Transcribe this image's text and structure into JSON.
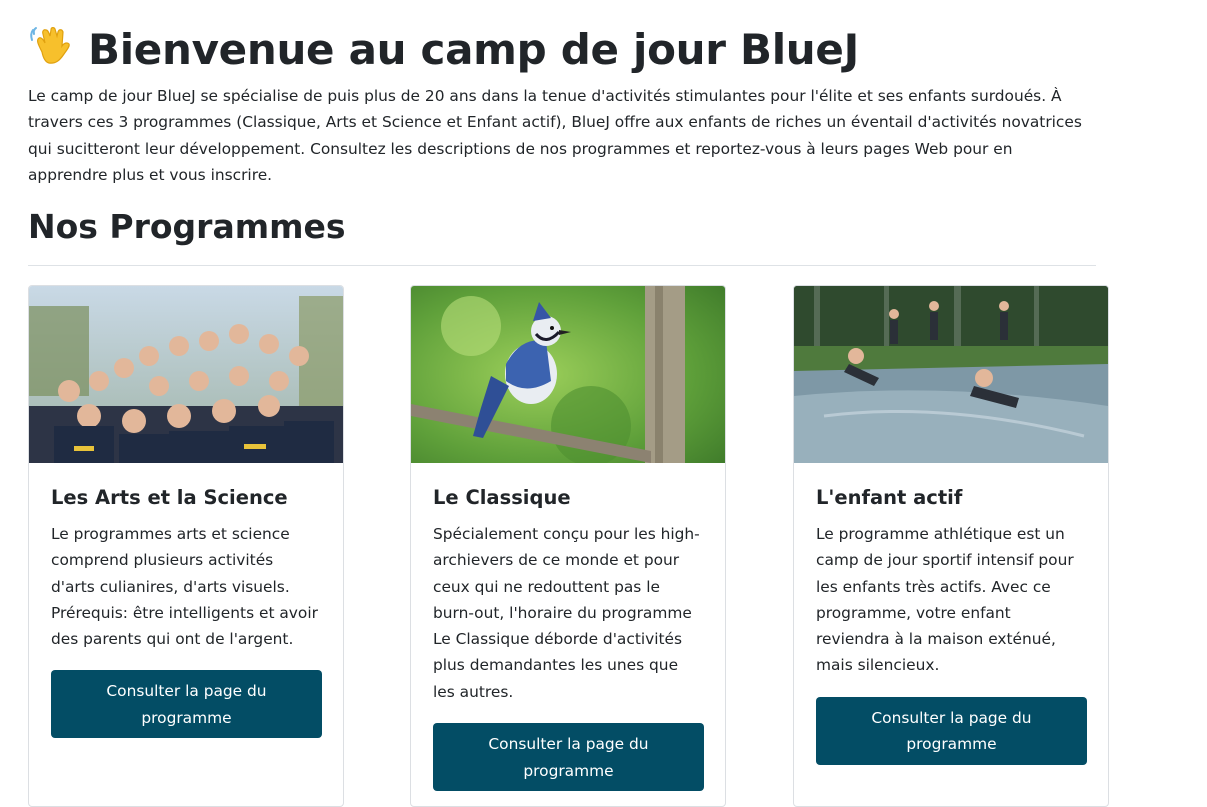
{
  "header": {
    "wave_icon": "waving-hand-icon",
    "title": "Bienvenue au camp de jour BlueJ",
    "intro": "Le camp de jour BlueJ se spécialise de puis plus de 20 ans dans la tenue d'activités stimulantes pour l'élite et ses enfants surdoués. À travers ces 3 programmes (Classique, Arts et Science et Enfant actif), BlueJ offre aux enfants de riches un éventail d'activités novatrices qui sucitteront leur développement. Consultez les descriptions de nos programmes et reportez-vous à leurs pages Web pour en apprendre plus et vous inscrire."
  },
  "programs_section": {
    "heading": "Nos Programmes",
    "cards": [
      {
        "title": "Les Arts et la Science",
        "text": "Le programmes arts et science comprend plusieurs activités d'arts culianires, d'arts visuels. Prérequis: être intelligents et avoir des parents qui ont de l'argent.",
        "button_label": "Consulter la page du programme"
      },
      {
        "title": "Le Classique",
        "text": "Spécialement conçu pour les high-archievers de ce monde et pour ceux qui ne redouttent pas le burn-out, l'horaire du programme Le Classique déborde d'activités plus demandantes les unes que les autres.",
        "button_label": "Consulter la page du programme"
      },
      {
        "title": "L'enfant actif",
        "text": "Le programme athlétique est un camp de jour sportif intensif pour les enfants très actifs. Avec ce programme, votre enfant reviendra à la maison exténué, mais silencieux.",
        "button_label": "Consulter la page du programme"
      }
    ]
  },
  "colors": {
    "button_bg": "#034d65",
    "text": "#212529",
    "divider": "#dee2e6"
  }
}
